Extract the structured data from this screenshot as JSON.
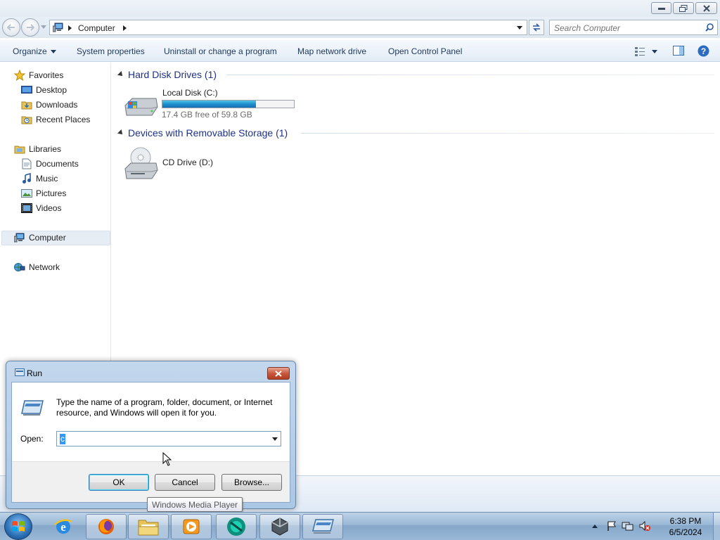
{
  "window": {
    "address_segments": [
      "Computer"
    ],
    "search_placeholder": "Search Computer"
  },
  "toolbar": {
    "organize": "Organize",
    "system_properties": "System properties",
    "uninstall": "Uninstall or change a program",
    "map_network": "Map network drive",
    "control_panel": "Open Control Panel"
  },
  "sidebar": {
    "favorites": {
      "label": "Favorites",
      "icon": "star-icon",
      "items": [
        {
          "label": "Desktop",
          "icon": "desktop-icon"
        },
        {
          "label": "Downloads",
          "icon": "downloads-folder-icon"
        },
        {
          "label": "Recent Places",
          "icon": "recent-places-icon"
        }
      ]
    },
    "libraries": {
      "label": "Libraries",
      "icon": "libraries-icon",
      "items": [
        {
          "label": "Documents",
          "icon": "documents-icon"
        },
        {
          "label": "Music",
          "icon": "music-icon"
        },
        {
          "label": "Pictures",
          "icon": "pictures-icon"
        },
        {
          "label": "Videos",
          "icon": "videos-icon"
        }
      ]
    },
    "computer": {
      "label": "Computer",
      "icon": "computer-icon",
      "selected": true
    },
    "network": {
      "label": "Network",
      "icon": "network-icon"
    }
  },
  "content": {
    "groups": [
      {
        "title": "Hard Disk Drives (1)",
        "drives": [
          {
            "name": "Local Disk (C:)",
            "free_text": "17.4 GB free of 59.8 GB",
            "used_fraction": 0.709,
            "icon": "hard-disk-icon"
          }
        ]
      },
      {
        "title": "Devices with Removable Storage (1)",
        "drives": [
          {
            "name": "CD Drive (D:)",
            "icon": "cd-drive-icon"
          }
        ]
      }
    ]
  },
  "run_dialog": {
    "title": "Run",
    "description": "Type the name of a program, folder, document, or Internet resource, and Windows will open it for you.",
    "open_label": "Open:",
    "open_value": "c",
    "ok": "OK",
    "cancel": "Cancel",
    "browse": "Browse..."
  },
  "tooltip": "Windows Media Player",
  "taskbar": {
    "pinned": [
      "internet-explorer-icon",
      "firefox-icon",
      "explorer-folder-icon",
      "media-player-icon",
      "app-globe-icon",
      "app-box-icon",
      "run-dialog-icon"
    ],
    "clock_time": "6:38 PM",
    "clock_date": "6/5/2024"
  },
  "colors": {
    "link_blue": "#1e395b",
    "group_header": "#1e3287",
    "drive_fill": "#1f8fcc",
    "taskbar": "#9ab8d6"
  }
}
